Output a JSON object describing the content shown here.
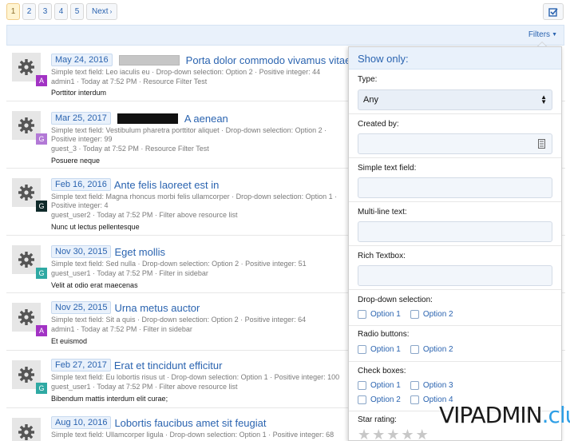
{
  "pagination": {
    "pages": [
      "1",
      "2",
      "3",
      "4",
      "5"
    ],
    "current": "1",
    "next_label": "Next"
  },
  "toolbar": {
    "select_icon": "checkbox-icon"
  },
  "filters_bar": {
    "label": "Filters"
  },
  "resources": [
    {
      "date": "May 24, 2016",
      "redaction": "grey",
      "title": "Porta dolor commodo vivamus vitae",
      "meta1": "Simple text field: Leo iaculis eu · Drop-down selection: Option 2 · Positive integer: 44",
      "meta2": "",
      "meta3": "admin1 · Today at 7:52 PM · Resource Filter Test",
      "snippet": "Porttitor interdum",
      "badge": "A",
      "badge_color": "#a233c4"
    },
    {
      "date": "Mar 25, 2017",
      "redaction": "black",
      "title": "A aenean",
      "meta1": "Simple text field: Vestibulum pharetra porttitor aliquet · Drop-down selection: Option 2 ·",
      "meta2": "Positive integer: 99",
      "meta3": "guest_3 · Today at 7:52 PM · Resource Filter Test",
      "snippet": "Posuere neque",
      "badge": "G",
      "badge_color": "#b279d6"
    },
    {
      "date": "Feb 16, 2016",
      "redaction": "",
      "title": "Ante felis laoreet est in",
      "meta1": "Simple text field: Magna rhoncus morbi felis ullamcorper · Drop-down selection: Option 1 ·",
      "meta2": "Positive integer: 4",
      "meta3": "guest_user2 · Today at 7:52 PM · Filter above resource list",
      "snippet": "Nunc ut lectus pellentesque",
      "badge": "G",
      "badge_color": "#0f2a2a"
    },
    {
      "date": "Nov 30, 2015",
      "redaction": "",
      "title": "Eget mollis",
      "meta1": "Simple text field: Sed nulla · Drop-down selection: Option 2 · Positive integer: 51",
      "meta2": "",
      "meta3": "guest_user1 · Today at 7:52 PM · Filter in sidebar",
      "snippet": "Velit at odio erat maecenas",
      "badge": "G",
      "badge_color": "#2fa9a3"
    },
    {
      "date": "Nov 25, 2015",
      "redaction": "",
      "title": "Urna metus auctor",
      "meta1": "Simple text field: Sit a quis · Drop-down selection: Option 2 · Positive integer: 64",
      "meta2": "",
      "meta3": "admin1 · Today at 7:52 PM · Filter in sidebar",
      "snippet": "Et euismod",
      "badge": "A",
      "badge_color": "#a233c4"
    },
    {
      "date": "Feb 27, 2017",
      "redaction": "",
      "title": "Erat et tincidunt efficitur",
      "meta1": "Simple text field: Eu lobortis risus ut · Drop-down selection: Option 1 · Positive integer: 100",
      "meta2": "",
      "meta3": "guest_user1 · Today at 7:52 PM · Filter above resource list",
      "snippet": "Bibendum mattis interdum elit curae;",
      "badge": "G",
      "badge_color": "#2fa9a3"
    },
    {
      "date": "Aug 10, 2016",
      "redaction": "",
      "title": "Lobortis faucibus amet sit feugiat",
      "meta1": "Simple text field: Ullamcorper ligula · Drop-down selection: Option 1 · Positive integer: 68",
      "meta2": "",
      "meta3": "",
      "snippet": "",
      "badge": "",
      "badge_color": "#2fa9a3"
    }
  ],
  "filter_panel": {
    "heading": "Show only:",
    "type_label": "Type:",
    "type_value": "Any",
    "created_by_label": "Created by:",
    "simple_text_label": "Simple text field:",
    "multiline_label": "Multi-line text:",
    "rich_textbox_label": "Rich Textbox:",
    "dropdown_label": "Drop-down selection:",
    "dropdown_options": [
      "Option 1",
      "Option 2"
    ],
    "radio_label": "Radio buttons:",
    "radio_options": [
      "Option 1",
      "Option 2"
    ],
    "checkboxes_label": "Check boxes:",
    "checkbox_options": [
      "Option 1",
      "Option 3",
      "Option 2",
      "Option 4"
    ],
    "star_label": "Star rating:",
    "star_rating": 0,
    "star_max": 5
  },
  "watermark": {
    "main": "VIPADMIN",
    "dot": ".",
    "suffix": "club"
  },
  "colors": {
    "link": "#2b64b0",
    "accent_bg": "#e9f1fb",
    "current_page_bg": "#fff4d1"
  }
}
